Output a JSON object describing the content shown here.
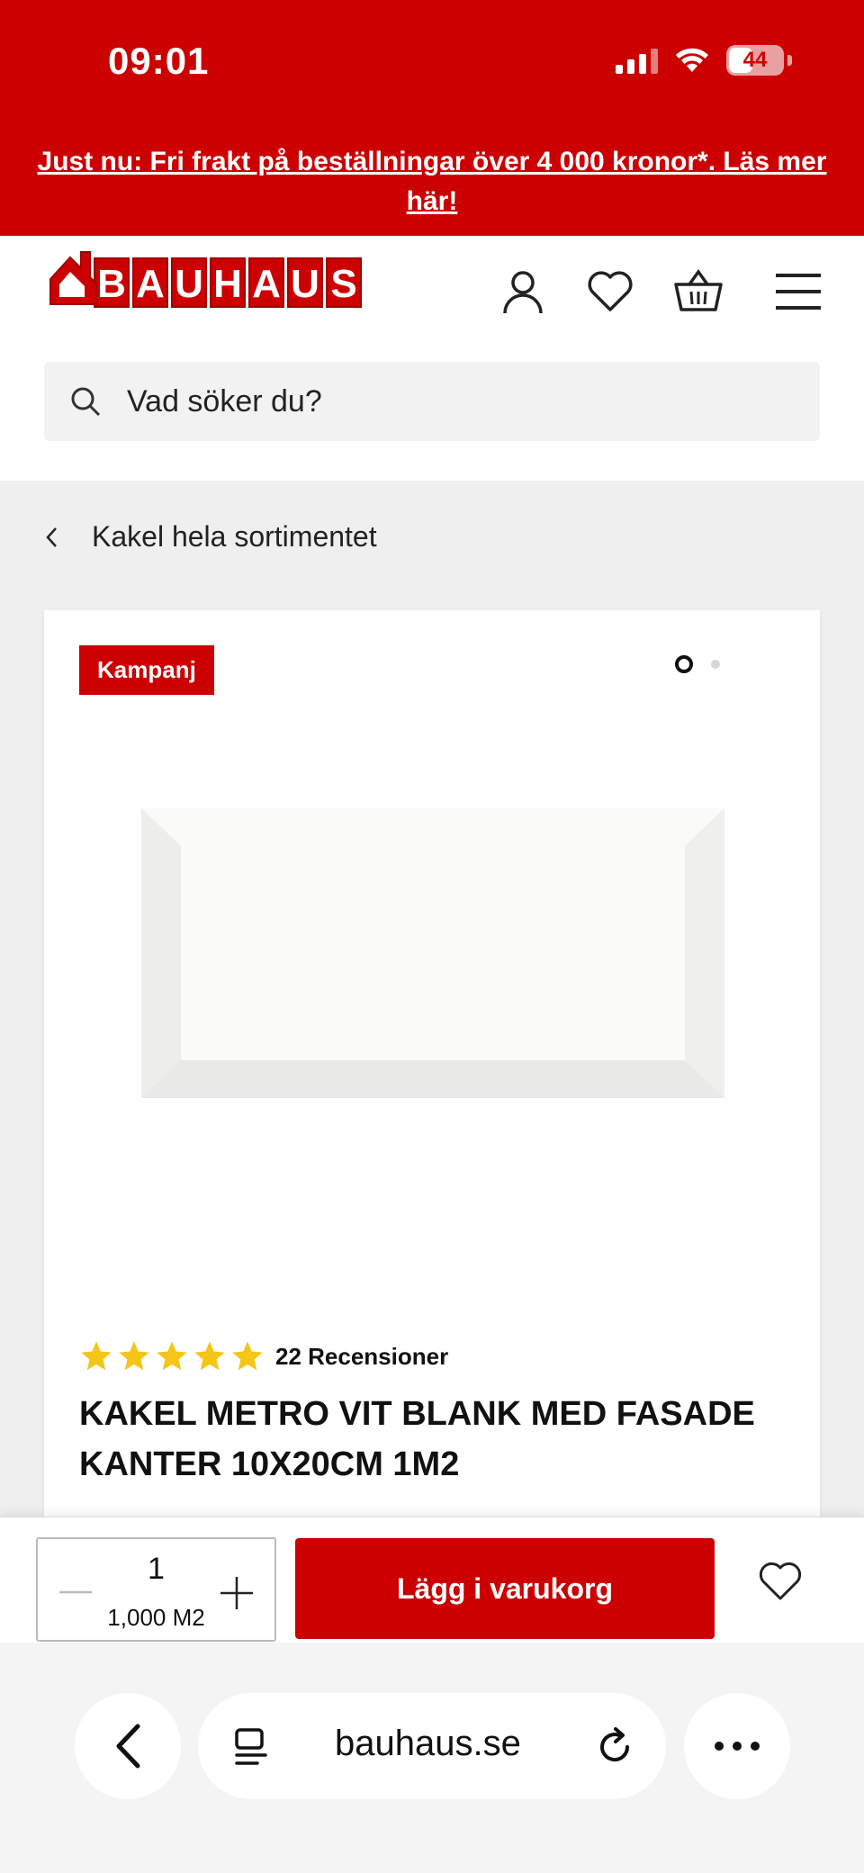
{
  "status_bar": {
    "time": "09:01",
    "battery": "44"
  },
  "promo": {
    "text": "Just nu: Fri frakt på beställningar över 4 000 kronor*. Läs mer här!"
  },
  "header": {
    "logo_letters": [
      "B",
      "A",
      "U",
      "H",
      "A",
      "U",
      "S"
    ],
    "search_placeholder": "Vad söker du?"
  },
  "breadcrumb": {
    "label": "Kakel hela sortimentet"
  },
  "product": {
    "badge": "Kampanj",
    "rating": 5,
    "reviews": "22 Recensioner",
    "title": "KAKEL METRO VIT BLANK MED FASADE KANTER 10X20CM 1M2",
    "image_count": 2,
    "active_image": 1
  },
  "cart": {
    "quantity": "1",
    "unit_amount": "1,000 M2",
    "add_label": "Lägg i varukorg"
  },
  "browser": {
    "url": "bauhaus.se"
  },
  "colors": {
    "brand_red": "#cc0000",
    "star": "#f5c518"
  }
}
